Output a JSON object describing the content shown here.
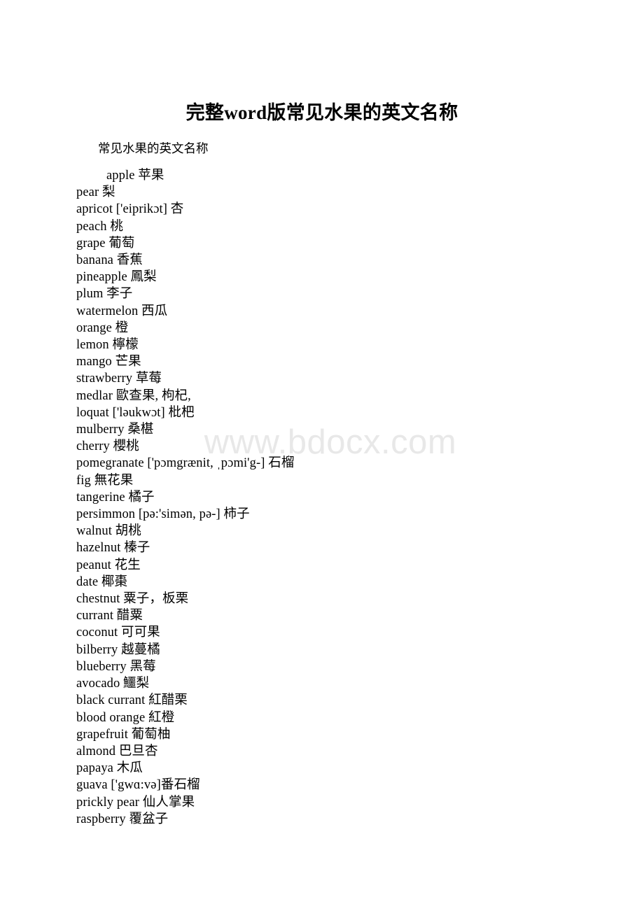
{
  "document": {
    "title": "完整word版常见水果的英文名称",
    "subtitle": "常见水果的英文名称",
    "watermark": "www.bdocx.com"
  },
  "fruit_terms": [
    {
      "text": "apple 苹果",
      "indent": true
    },
    {
      "text": "pear 梨",
      "indent": false
    },
    {
      "text": "apricot ['eiprikɔt] 杏",
      "indent": false
    },
    {
      "text": "peach 桃",
      "indent": false
    },
    {
      "text": "grape 葡萄",
      "indent": false
    },
    {
      "text": "banana 香蕉",
      "indent": false
    },
    {
      "text": "pineapple 鳳梨",
      "indent": false
    },
    {
      "text": "plum 李子",
      "indent": false
    },
    {
      "text": "watermelon 西瓜",
      "indent": false
    },
    {
      "text": "orange 橙",
      "indent": false
    },
    {
      "text": "lemon 檸檬",
      "indent": false
    },
    {
      "text": "mango 芒果",
      "indent": false
    },
    {
      "text": "strawberry 草莓",
      "indent": false
    },
    {
      "text": "medlar 歐查果, 枸杞,",
      "indent": false
    },
    {
      "text": "loquat ['ləukwɔt] 枇杷",
      "indent": false
    },
    {
      "text": "mulberry 桑椹",
      "indent": false
    },
    {
      "text": "cherry 櫻桃",
      "indent": false
    },
    {
      "text": "pomegranate ['pɔmgrænit, ˌpɔmi'g-] 石榴",
      "indent": false
    },
    {
      "text": "fig 無花果",
      "indent": false
    },
    {
      "text": "tangerine 橘子",
      "indent": false
    },
    {
      "text": "persimmon [pə:'simən, pə-] 柿子",
      "indent": false
    },
    {
      "text": "walnut 胡桃",
      "indent": false
    },
    {
      "text": "hazelnut 榛子",
      "indent": false
    },
    {
      "text": "peanut 花生",
      "indent": false
    },
    {
      "text": "date 椰棗",
      "indent": false
    },
    {
      "text": "chestnut 粟子，板栗",
      "indent": false
    },
    {
      "text": "currant 醋粟",
      "indent": false
    },
    {
      "text": "coconut 可可果",
      "indent": false
    },
    {
      "text": "bilberry 越蔓橘",
      "indent": false
    },
    {
      "text": "blueberry 黑莓",
      "indent": false
    },
    {
      "text": "avocado 鱷梨",
      "indent": false
    },
    {
      "text": "black currant 紅醋栗",
      "indent": false
    },
    {
      "text": "blood orange 紅橙",
      "indent": false
    },
    {
      "text": "grapefruit 葡萄柚",
      "indent": false
    },
    {
      "text": "almond 巴旦杏",
      "indent": false
    },
    {
      "text": "papaya 木瓜",
      "indent": false
    },
    {
      "text": "guava ['gwɑ:və]番石榴",
      "indent": false
    },
    {
      "text": "prickly pear 仙人掌果",
      "indent": false
    },
    {
      "text": "raspberry 覆盆子",
      "indent": false
    }
  ]
}
